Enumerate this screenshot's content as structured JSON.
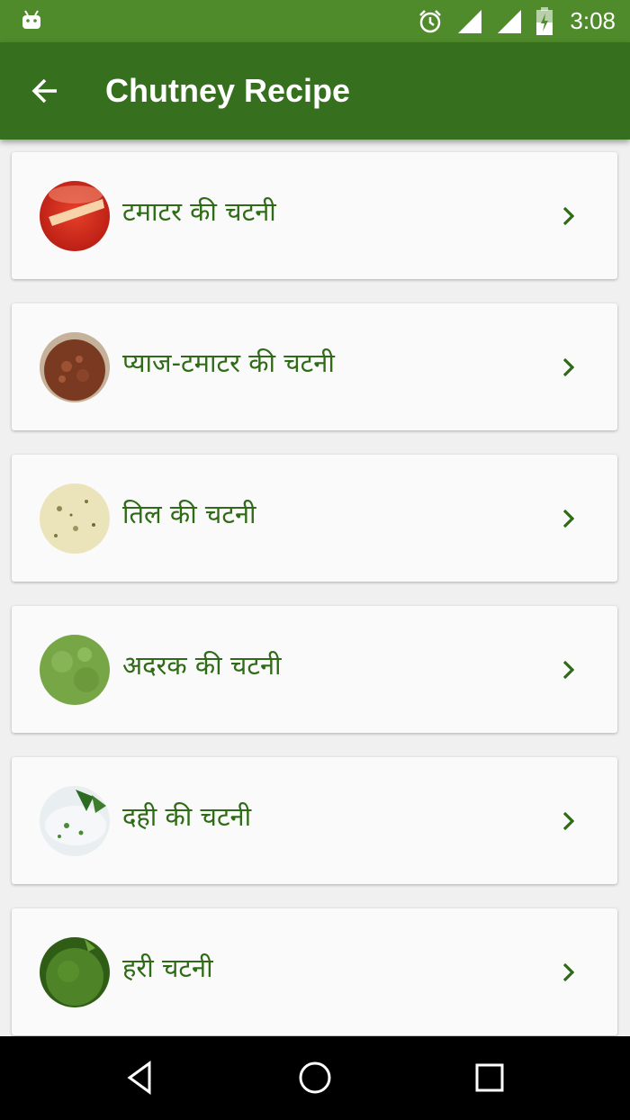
{
  "status_bar": {
    "time": "3:08"
  },
  "app_bar": {
    "title": "Chutney Recipe"
  },
  "recipes": [
    {
      "label": "टमाटर की चटनी",
      "thumb_colors": [
        "#d72a1f",
        "#f4c7a0"
      ]
    },
    {
      "label": "प्याज-टमाटर की चटनी",
      "thumb_colors": [
        "#7b3a22",
        "#a85a3a"
      ]
    },
    {
      "label": "तिल की चटनी",
      "thumb_colors": [
        "#e9e2b7",
        "#c9bb82"
      ]
    },
    {
      "label": "अदरक की चटनी",
      "thumb_colors": [
        "#6a9b3a",
        "#8fb860"
      ]
    },
    {
      "label": "दही की चटनी",
      "thumb_colors": [
        "#eef1f3",
        "#3c7a2c"
      ]
    },
    {
      "label": "हरी चटनी",
      "thumb_colors": [
        "#3d6f1c",
        "#5a8f2a"
      ]
    }
  ],
  "colors": {
    "status_bar": "#4f8a2b",
    "app_bar": "#366f1e",
    "accent_text": "#2f6b16"
  }
}
